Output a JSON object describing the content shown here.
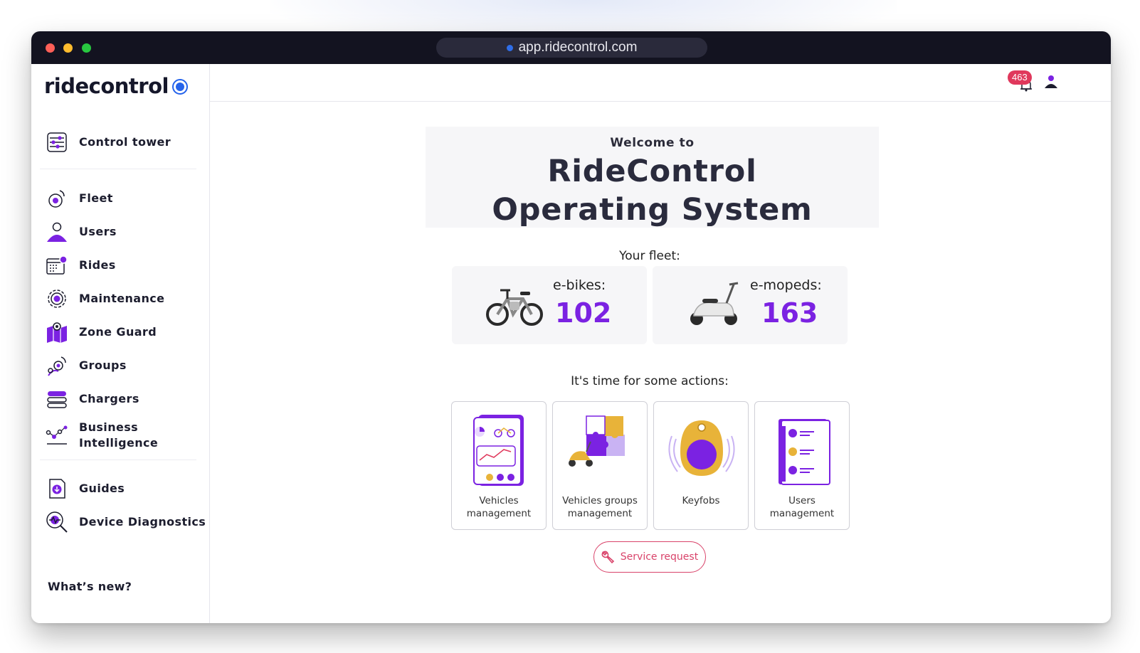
{
  "browser": {
    "url": "app.ridecontrol.com"
  },
  "sidebar": {
    "logo_text": "ridecontrol",
    "items": [
      {
        "label": "Control tower",
        "icon": "control-tower-icon"
      },
      {
        "label": "Fleet",
        "icon": "fleet-icon"
      },
      {
        "label": "Users",
        "icon": "users-icon"
      },
      {
        "label": "Rides",
        "icon": "rides-icon"
      },
      {
        "label": "Maintenance",
        "icon": "maintenance-icon"
      },
      {
        "label": "Zone Guard",
        "icon": "zone-guard-icon"
      },
      {
        "label": "Groups",
        "icon": "groups-icon"
      },
      {
        "label": "Chargers",
        "icon": "chargers-icon"
      },
      {
        "label": "Business Intelligence",
        "icon": "business-intelligence-icon"
      },
      {
        "label": "Guides",
        "icon": "guides-icon"
      },
      {
        "label": "Device Diagnostics",
        "icon": "device-diagnostics-icon"
      }
    ],
    "whats_new": "What’s new?"
  },
  "topbar": {
    "notification_count": "463"
  },
  "main": {
    "welcome_to": "Welcome to",
    "title_line1": "RideControl",
    "title_line2": "Operating System",
    "fleet_label": "Your fleet:",
    "fleet": [
      {
        "label": "e-bikes:",
        "value": "102"
      },
      {
        "label": "e-mopeds:",
        "value": "163"
      }
    ],
    "actions_label": "It's time for some actions:",
    "actions": [
      {
        "label": "Vehicles management"
      },
      {
        "label": "Vehicles groups management"
      },
      {
        "label": "Keyfobs"
      },
      {
        "label": "Users management"
      }
    ],
    "service_request": "Service request"
  },
  "colors": {
    "accent_purple": "#7b22e2",
    "brand_blue": "#2563eb",
    "service_red": "#d9436a",
    "badge_red": "#e0385c",
    "titlebar": "#131320"
  }
}
